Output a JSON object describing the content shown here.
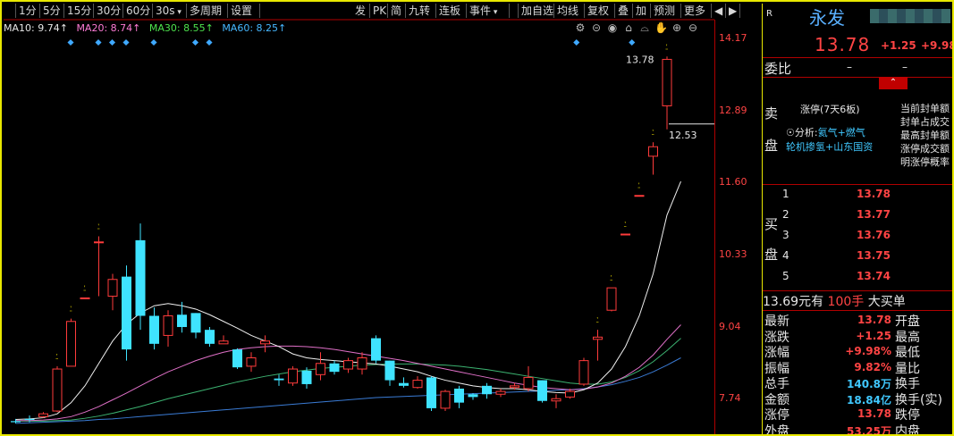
{
  "toolbar": {
    "items": [
      "",
      "1分",
      "5分",
      "15分",
      "30分",
      "60分",
      "30s",
      "多周期",
      "设置"
    ],
    "right_items": [
      "发",
      "PK",
      "简",
      "九转",
      "连板",
      "事件",
      "",
      "加自选",
      "均线",
      "复权",
      "叠",
      "加",
      "预测",
      "更多",
      "◀",
      "▶"
    ]
  },
  "ma_legend": {
    "ma10": "MA10: 9.74↑",
    "ma20": "MA20: 8.74↑",
    "ma30": "MA30: 8.55↑",
    "ma60": "MA60: 8.25↑"
  },
  "price_axis": {
    "ticks": [
      "14.17",
      "12.89",
      "11.60",
      "10.33",
      "9.04",
      "7.74"
    ]
  },
  "chart_annotations": {
    "high_label": "13.78",
    "last_label": "12.53"
  },
  "chart_data": {
    "type": "candlestick",
    "ylim": [
      7.3,
      14.35
    ],
    "candles": [
      {
        "o": 7.32,
        "c": 7.3,
        "h": 7.36,
        "l": 7.28,
        "limit": false,
        "event": false
      },
      {
        "o": 7.36,
        "c": 7.34,
        "h": 7.42,
        "l": 7.3,
        "limit": false,
        "event": false
      },
      {
        "o": 7.4,
        "c": 7.45,
        "h": 7.48,
        "l": 7.38,
        "limit": false,
        "event": false
      },
      {
        "o": 7.5,
        "c": 8.25,
        "h": 8.3,
        "l": 7.48,
        "limit": true,
        "event": false
      },
      {
        "o": 8.3,
        "c": 9.1,
        "h": 9.15,
        "l": 8.3,
        "limit": true,
        "event": true
      },
      {
        "o": 9.52,
        "c": 9.52,
        "h": 9.52,
        "l": 9.52,
        "limit": true,
        "event": false
      },
      {
        "o": 10.52,
        "c": 10.52,
        "h": 10.62,
        "l": 9.55,
        "limit": true,
        "event": true
      },
      {
        "o": 9.55,
        "c": 9.85,
        "h": 9.95,
        "l": 9.3,
        "limit": false,
        "event": true
      },
      {
        "o": 9.9,
        "c": 8.6,
        "h": 10.1,
        "l": 8.4,
        "limit": false,
        "event": true
      },
      {
        "o": 10.55,
        "c": 9.2,
        "h": 10.85,
        "l": 8.95,
        "limit": false,
        "event": false
      },
      {
        "o": 9.2,
        "c": 8.7,
        "h": 9.35,
        "l": 8.6,
        "limit": false,
        "event": true
      },
      {
        "o": 8.85,
        "c": 9.2,
        "h": 9.3,
        "l": 8.65,
        "limit": false,
        "event": false
      },
      {
        "o": 9.22,
        "c": 9.0,
        "h": 9.45,
        "l": 8.9,
        "limit": false,
        "event": false
      },
      {
        "o": 9.25,
        "c": 8.9,
        "h": 9.25,
        "l": 8.8,
        "limit": false,
        "event": true
      },
      {
        "o": 8.95,
        "c": 8.7,
        "h": 9.0,
        "l": 8.65,
        "limit": false,
        "event": true
      },
      {
        "o": 8.7,
        "c": 8.75,
        "h": 8.85,
        "l": 8.7,
        "limit": false,
        "event": false
      },
      {
        "o": 8.6,
        "c": 8.28,
        "h": 8.62,
        "l": 8.25,
        "limit": false,
        "event": false
      },
      {
        "o": 8.3,
        "c": 8.45,
        "h": 8.55,
        "l": 8.2,
        "limit": false,
        "event": false
      },
      {
        "o": 8.7,
        "c": 8.75,
        "h": 8.85,
        "l": 8.55,
        "limit": false,
        "event": false
      },
      {
        "o": 8.08,
        "c": 8.05,
        "h": 8.15,
        "l": 7.95,
        "limit": false,
        "event": false
      },
      {
        "o": 8.0,
        "c": 8.25,
        "h": 8.3,
        "l": 7.95,
        "limit": false,
        "event": false
      },
      {
        "o": 8.22,
        "c": 7.98,
        "h": 8.28,
        "l": 7.9,
        "limit": false,
        "event": false
      },
      {
        "o": 8.15,
        "c": 8.35,
        "h": 8.55,
        "l": 8.05,
        "limit": false,
        "event": false
      },
      {
        "o": 8.35,
        "c": 8.2,
        "h": 8.4,
        "l": 8.15,
        "limit": false,
        "event": false
      },
      {
        "o": 8.25,
        "c": 8.4,
        "h": 8.45,
        "l": 8.18,
        "limit": false,
        "event": false
      },
      {
        "o": 8.25,
        "c": 8.45,
        "h": 8.55,
        "l": 8.15,
        "limit": false,
        "event": false
      },
      {
        "o": 8.8,
        "c": 8.4,
        "h": 8.85,
        "l": 8.35,
        "limit": false,
        "event": false
      },
      {
        "o": 8.4,
        "c": 8.05,
        "h": 8.4,
        "l": 7.95,
        "limit": false,
        "event": false
      },
      {
        "o": 8.0,
        "c": 7.95,
        "h": 8.1,
        "l": 7.92,
        "limit": false,
        "event": false
      },
      {
        "o": 7.92,
        "c": 8.05,
        "h": 8.12,
        "l": 7.9,
        "limit": false,
        "event": false
      },
      {
        "o": 8.1,
        "c": 7.55,
        "h": 8.12,
        "l": 7.5,
        "limit": false,
        "event": false
      },
      {
        "o": 7.55,
        "c": 7.85,
        "h": 7.88,
        "l": 7.5,
        "limit": false,
        "event": false
      },
      {
        "o": 7.9,
        "c": 7.65,
        "h": 7.95,
        "l": 7.55,
        "limit": false,
        "event": false
      },
      {
        "o": 7.8,
        "c": 7.75,
        "h": 7.82,
        "l": 7.7,
        "limit": false,
        "event": false
      },
      {
        "o": 7.95,
        "c": 7.8,
        "h": 8.0,
        "l": 7.72,
        "limit": false,
        "event": false
      },
      {
        "o": 7.8,
        "c": 7.85,
        "h": 7.9,
        "l": 7.75,
        "limit": false,
        "event": false
      },
      {
        "o": 7.92,
        "c": 7.95,
        "h": 8.0,
        "l": 7.88,
        "limit": false,
        "event": false
      },
      {
        "o": 7.9,
        "c": 8.1,
        "h": 8.3,
        "l": 7.85,
        "limit": false,
        "event": false
      },
      {
        "o": 8.05,
        "c": 7.68,
        "h": 8.05,
        "l": 7.65,
        "limit": false,
        "event": false
      },
      {
        "o": 7.68,
        "c": 7.72,
        "h": 7.8,
        "l": 7.55,
        "limit": false,
        "event": false
      },
      {
        "o": 7.75,
        "c": 7.85,
        "h": 7.9,
        "l": 7.72,
        "limit": false,
        "event": false
      },
      {
        "o": 7.98,
        "c": 8.4,
        "h": 8.45,
        "l": 7.95,
        "limit": false,
        "event": false
      },
      {
        "o": 8.78,
        "c": 8.82,
        "h": 8.95,
        "l": 8.4,
        "limit": true,
        "event": false
      },
      {
        "o": 9.3,
        "c": 9.7,
        "h": 9.7,
        "l": 9.28,
        "limit": true,
        "event": false
      },
      {
        "o": 10.66,
        "c": 10.66,
        "h": 10.66,
        "l": 10.66,
        "limit": true,
        "event": false
      },
      {
        "o": 11.35,
        "c": 11.35,
        "h": 11.35,
        "l": 11.35,
        "limit": true,
        "event": false
      },
      {
        "o": 12.05,
        "c": 12.22,
        "h": 12.3,
        "l": 11.72,
        "limit": true,
        "event": false
      },
      {
        "o": 12.95,
        "c": 13.78,
        "h": 13.83,
        "l": 12.53,
        "limit": true,
        "event": false
      }
    ],
    "ma10": [
      7.35,
      7.36,
      7.38,
      7.45,
      7.65,
      7.95,
      8.35,
      8.75,
      9.05,
      9.25,
      9.38,
      9.42,
      9.38,
      9.32,
      9.22,
      9.1,
      8.98,
      8.85,
      8.75,
      8.65,
      8.52,
      8.45,
      8.42,
      8.4,
      8.38,
      8.36,
      8.34,
      8.3,
      8.25,
      8.2,
      8.12,
      8.05,
      8.0,
      7.95,
      7.92,
      7.9,
      7.9,
      7.88,
      7.85,
      7.83,
      7.82,
      7.88,
      8.0,
      8.25,
      8.65,
      9.2,
      9.95,
      11.0,
      11.6
    ],
    "ma20": [
      7.33,
      7.33,
      7.34,
      7.36,
      7.4,
      7.48,
      7.58,
      7.7,
      7.82,
      7.95,
      8.08,
      8.2,
      8.3,
      8.4,
      8.48,
      8.55,
      8.6,
      8.63,
      8.65,
      8.66,
      8.66,
      8.65,
      8.63,
      8.6,
      8.56,
      8.52,
      8.48,
      8.44,
      8.4,
      8.35,
      8.3,
      8.25,
      8.2,
      8.15,
      8.1,
      8.05,
      8.0,
      7.96,
      7.92,
      7.9,
      7.88,
      7.89,
      7.93,
      8.0,
      8.12,
      8.28,
      8.5,
      8.78,
      9.04
    ],
    "ma30": [
      7.32,
      7.32,
      7.32,
      7.33,
      7.34,
      7.37,
      7.41,
      7.46,
      7.52,
      7.58,
      7.65,
      7.72,
      7.78,
      7.84,
      7.9,
      7.96,
      8.02,
      8.07,
      8.12,
      8.16,
      8.2,
      8.23,
      8.26,
      8.28,
      8.3,
      8.32,
      8.33,
      8.34,
      8.34,
      8.34,
      8.33,
      8.32,
      8.3,
      8.27,
      8.24,
      8.2,
      8.16,
      8.12,
      8.08,
      8.04,
      8.0,
      7.98,
      7.98,
      8.02,
      8.1,
      8.22,
      8.38,
      8.58,
      8.8
    ],
    "ma60": [
      7.28,
      7.29,
      7.3,
      7.31,
      7.32,
      7.33,
      7.35,
      7.36,
      7.38,
      7.4,
      7.42,
      7.44,
      7.46,
      7.48,
      7.5,
      7.52,
      7.54,
      7.56,
      7.58,
      7.6,
      7.62,
      7.64,
      7.66,
      7.68,
      7.7,
      7.72,
      7.74,
      7.75,
      7.76,
      7.77,
      7.78,
      7.79,
      7.8,
      7.81,
      7.82,
      7.83,
      7.84,
      7.85,
      7.86,
      7.87,
      7.88,
      7.9,
      7.93,
      7.97,
      8.03,
      8.1,
      8.2,
      8.32,
      8.45
    ]
  },
  "panel": {
    "r_label": "R",
    "stock_name": "永发",
    "price": "13.78",
    "change": "+1.25",
    "change_pct": "+9.98",
    "weibi_label": "委比",
    "weibi_val1": "–",
    "weibi_val2": "–",
    "sell_label_1": "卖",
    "sell_label_2": "盘",
    "limit_title": "涨停(7天6板)",
    "analysis_prefix": "分析:",
    "analysis_tags": "氦气+燃气",
    "analysis_line2": "轮机掺氢+山东国资",
    "right_info": [
      "当前封单额",
      "封单占成交",
      "最高封单额",
      "涨停成交额",
      "明涨停概率"
    ],
    "buy_label_1": "买",
    "buy_label_2": "盘",
    "buy_levels": [
      {
        "n": "1",
        "price": "13.78"
      },
      {
        "n": "2",
        "price": "13.77"
      },
      {
        "n": "3",
        "price": "13.76"
      },
      {
        "n": "4",
        "price": "13.75"
      },
      {
        "n": "5",
        "price": "13.74"
      }
    ],
    "order_price": "13.69元有",
    "order_qty": "100手",
    "order_text": "大买单",
    "stats": [
      {
        "label": "最新",
        "value": "13.78",
        "label2": "开盘"
      },
      {
        "label": "涨跌",
        "value": "+1.25",
        "label2": "最高"
      },
      {
        "label": "涨幅",
        "value": "+9.98%",
        "label2": "最低"
      },
      {
        "label": "振幅",
        "value": "9.82%",
        "label2": "量比"
      },
      {
        "label": "总手",
        "value": "140.8万",
        "label2": "换手"
      },
      {
        "label": "金额",
        "value": "18.84亿",
        "label2": "换手(实)"
      },
      {
        "label": "涨停",
        "value": "13.78",
        "label2": "跌停"
      },
      {
        "label": "外盘",
        "value": "53.25万",
        "label2": "内盘"
      }
    ]
  }
}
